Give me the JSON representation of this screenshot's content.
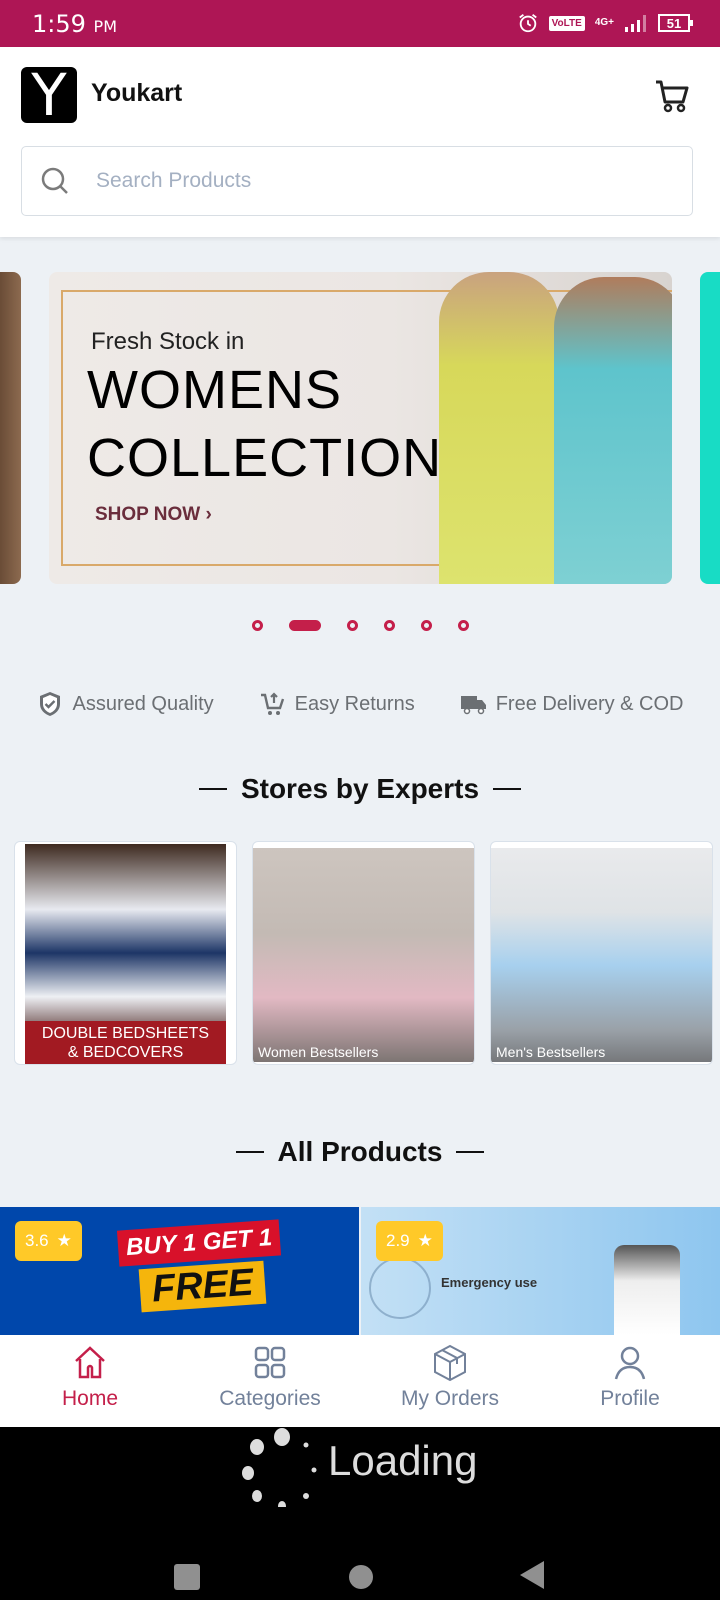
{
  "status_bar": {
    "time": "1:59",
    "ampm": "PM",
    "volte": "VoLTE",
    "network": "4G+",
    "battery": "51"
  },
  "header": {
    "logo_letter": "Y",
    "brand": "Youkart",
    "search_placeholder": "Search Products",
    "search_value": ""
  },
  "carousel": {
    "slide": {
      "subtitle": "Fresh Stock in",
      "title_line1": "WOMENS",
      "title_line2": "COLLECTION",
      "cta": "SHOP NOW ›"
    },
    "total_slides": 6,
    "active_index": 1
  },
  "features": [
    {
      "icon": "shield-check-icon",
      "label": "Assured Quality"
    },
    {
      "icon": "cart-return-icon",
      "label": "Easy Returns"
    },
    {
      "icon": "truck-icon",
      "label": "Free Delivery & COD"
    }
  ],
  "stores_section": {
    "title": "Stores by Experts",
    "stores": [
      {
        "label_line1": "DOUBLE BEDSHEETS",
        "label_line2": "& BEDCOVERS"
      },
      {
        "label": "Women Bestsellers"
      },
      {
        "label": "Men's Bestsellers"
      }
    ]
  },
  "products_section": {
    "title": "All Products",
    "products": [
      {
        "rating": "3.6",
        "promo_line1": "BUY 1 GET 1",
        "promo_line2": "FREE"
      },
      {
        "rating": "2.9",
        "promo_text": "Emergency use"
      }
    ]
  },
  "bottom_nav": {
    "items": [
      {
        "label": "Home",
        "icon": "home-icon",
        "active": true
      },
      {
        "label": "Categories",
        "icon": "grid-icon",
        "active": false
      },
      {
        "label": "My Orders",
        "icon": "box-icon",
        "active": false
      },
      {
        "label": "Profile",
        "icon": "user-icon",
        "active": false
      }
    ]
  },
  "overlay": {
    "loading_text": "Loading"
  },
  "colors": {
    "brand": "#ae1655",
    "accent": "#c41f4a",
    "rating_badge": "#ffc928",
    "nav_inactive": "#72819a"
  }
}
